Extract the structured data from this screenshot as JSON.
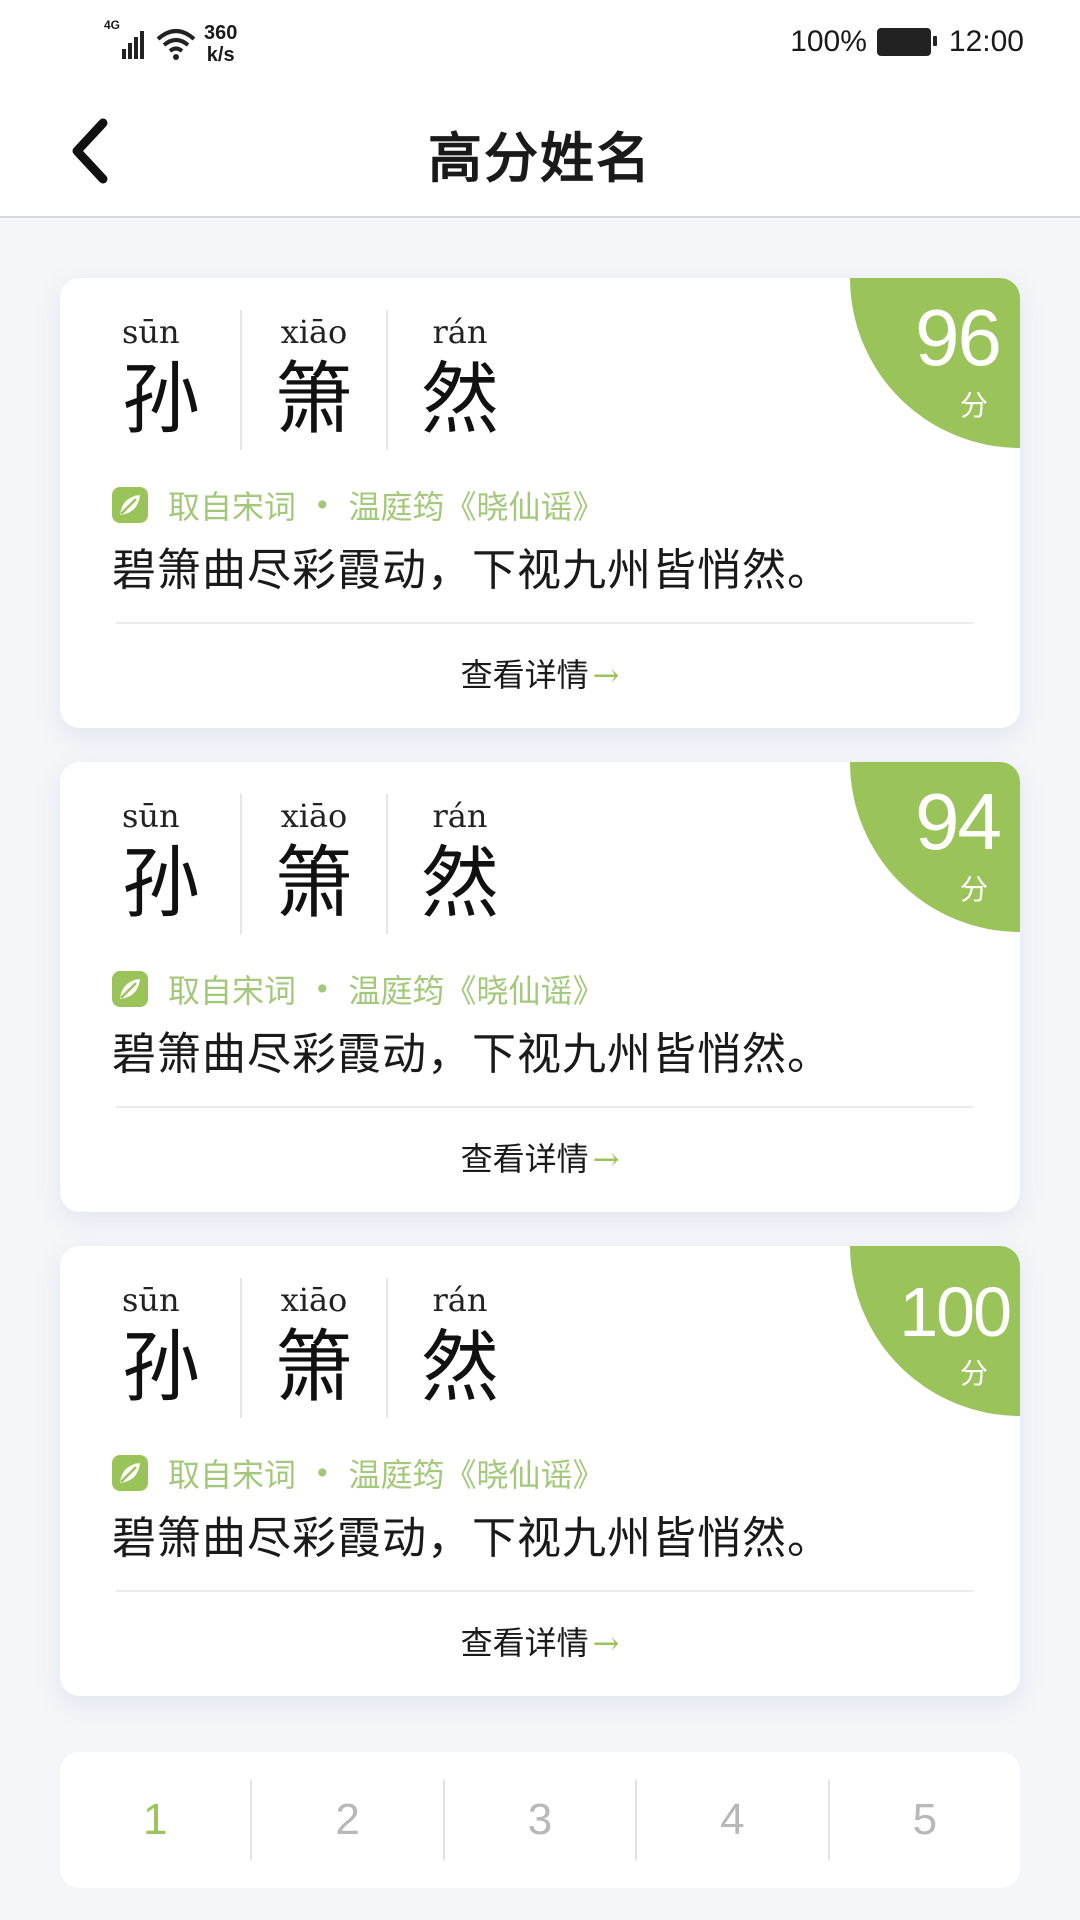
{
  "status_bar": {
    "network": "4G",
    "speed_value": "360",
    "speed_unit": "k/s",
    "battery": "100%",
    "time": "12:00"
  },
  "header": {
    "title": "高分姓名",
    "back_icon": "chevron-left-icon"
  },
  "cards": [
    {
      "chars": [
        {
          "pinyin": "sūn",
          "hanzi": "孙"
        },
        {
          "pinyin": "xiāo",
          "hanzi": "箫"
        },
        {
          "pinyin": "rán",
          "hanzi": "然"
        }
      ],
      "score": "96",
      "score_unit": "分",
      "source_label": "取自宋词",
      "source_work": "温庭筠《晓仙谣》",
      "verse": "碧箫曲尽彩霞动，下视九州皆悄然。",
      "detail_label": "查看详情"
    },
    {
      "chars": [
        {
          "pinyin": "sūn",
          "hanzi": "孙"
        },
        {
          "pinyin": "xiāo",
          "hanzi": "箫"
        },
        {
          "pinyin": "rán",
          "hanzi": "然"
        }
      ],
      "score": "94",
      "score_unit": "分",
      "source_label": "取自宋词",
      "source_work": "温庭筠《晓仙谣》",
      "verse": "碧箫曲尽彩霞动，下视九州皆悄然。",
      "detail_label": "查看详情"
    },
    {
      "chars": [
        {
          "pinyin": "sūn",
          "hanzi": "孙"
        },
        {
          "pinyin": "xiāo",
          "hanzi": "箫"
        },
        {
          "pinyin": "rán",
          "hanzi": "然"
        }
      ],
      "score": "100",
      "score_unit": "分",
      "source_label": "取自宋词",
      "source_work": "温庭筠《晓仙谣》",
      "verse": "碧箫曲尽彩霞动，下视九州皆悄然。",
      "detail_label": "查看详情"
    }
  ],
  "pagination": {
    "pages": [
      "1",
      "2",
      "3",
      "4",
      "5"
    ],
    "active": "1"
  },
  "colors": {
    "accent": "#9ac35a",
    "source_text": "#a4c87a",
    "background": "#f4f6f9"
  }
}
